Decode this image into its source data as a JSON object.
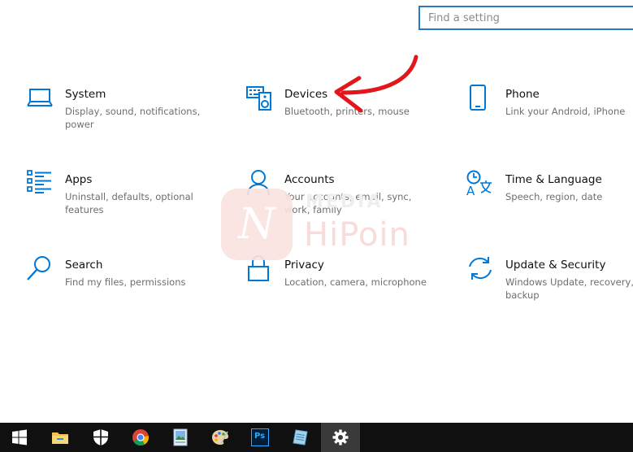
{
  "search": {
    "placeholder": "Find a setting"
  },
  "colors": {
    "accent": "#0078d7",
    "annotation_arrow": "#e3161b",
    "taskbar": "#101010"
  },
  "tiles": [
    {
      "title": "System",
      "desc": "Display, sound, notifications, power",
      "icon": "laptop-icon"
    },
    {
      "title": "Devices",
      "desc": "Bluetooth, printers, mouse",
      "icon": "keyboard-speaker-icon"
    },
    {
      "title": "Phone",
      "desc": "Link your Android, iPhone",
      "icon": "phone-icon"
    },
    {
      "title": "Apps",
      "desc": "Uninstall, defaults, optional features",
      "icon": "apps-list-icon"
    },
    {
      "title": "Accounts",
      "desc": "Your accounts, email, sync, work, family",
      "icon": "person-icon"
    },
    {
      "title": "Time & Language",
      "desc": "Speech, region, date",
      "icon": "time-language-icon"
    },
    {
      "title": "Search",
      "desc": "Find my files, permissions",
      "icon": "magnifier-icon"
    },
    {
      "title": "Privacy",
      "desc": "Location, camera, microphone",
      "icon": "lock-icon"
    },
    {
      "title": "Update & Security",
      "desc": "Windows Update, recovery, backup",
      "icon": "sync-arrows-icon"
    }
  ],
  "watermark": {
    "top": "MEDIA",
    "bottom": "HiPoin"
  },
  "taskbar": {
    "items": [
      {
        "icon": "windows-start-icon"
      },
      {
        "icon": "file-explorer-icon"
      },
      {
        "icon": "windows-security-icon"
      },
      {
        "icon": "chrome-icon"
      },
      {
        "icon": "image-viewer-icon"
      },
      {
        "icon": "paint-palette-icon"
      },
      {
        "icon": "photoshop-icon",
        "label": "Ps"
      },
      {
        "icon": "notepad-icon"
      },
      {
        "icon": "settings-gear-icon"
      }
    ]
  }
}
